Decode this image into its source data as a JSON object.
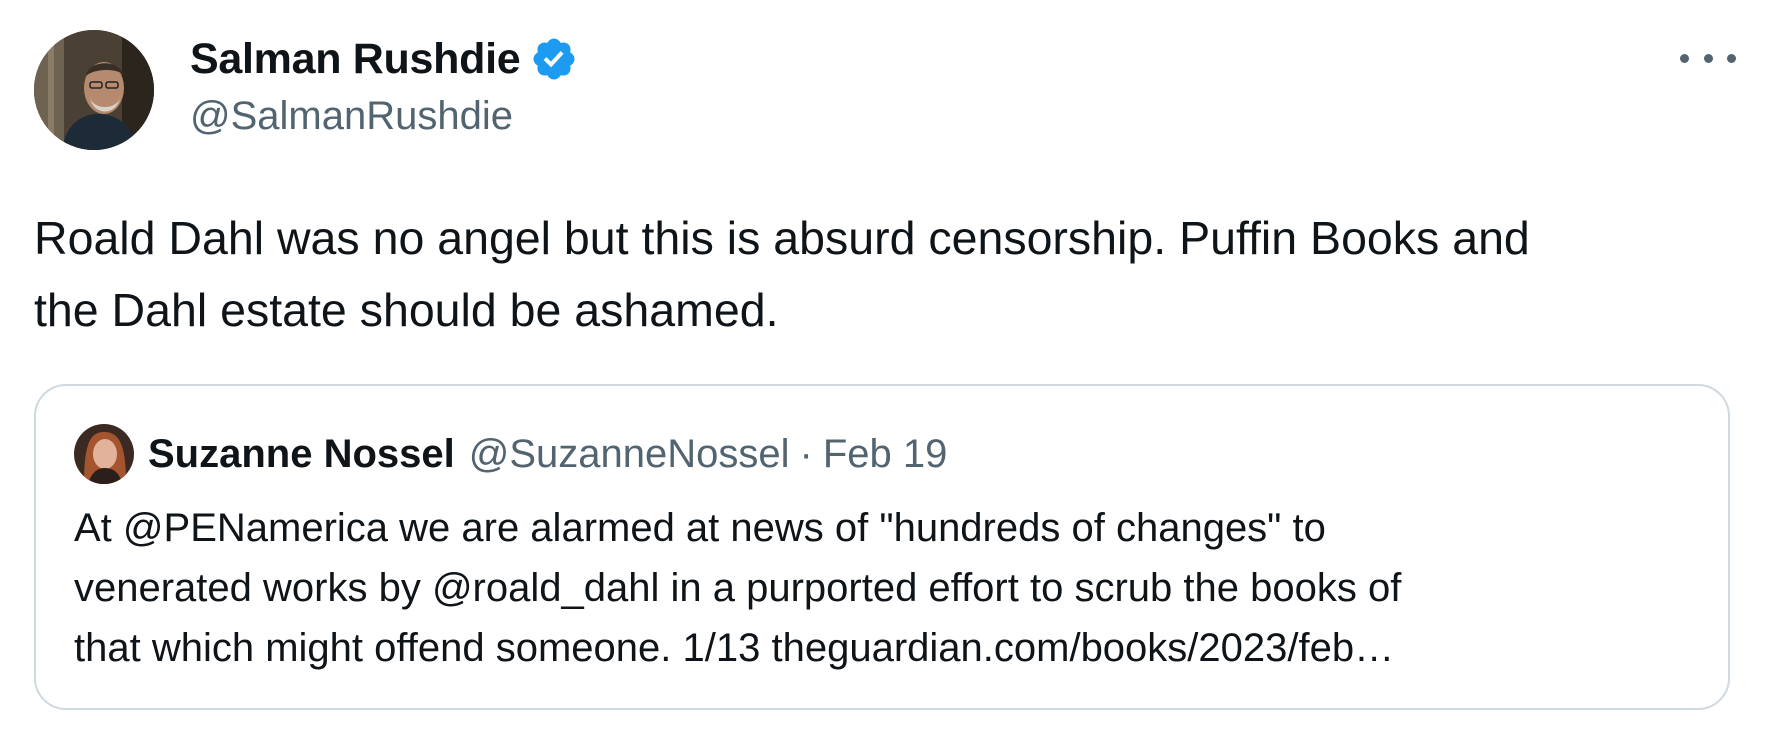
{
  "tweet": {
    "author": {
      "display_name": "Salman Rushdie",
      "handle": "@SalmanRushdie",
      "verified": true
    },
    "text_line1": "Roald Dahl was no angel but this is absurd censorship. Puffin Books and",
    "text_line2": "the Dahl estate should be ashamed.",
    "menu_icon": "more-horizontal-icon",
    "quoted": {
      "display_name": "Suzanne Nossel",
      "handle": "@SuzanneNossel",
      "separator": "·",
      "date": "Feb 19",
      "text_line1": "At @PENamerica we are alarmed at news of \"hundreds of changes\" to",
      "text_line2": "venerated works by @roald_dahl in a purported effort to scrub the books of",
      "text_line3": "that which might offend someone. 1/13 theguardian.com/books/2023/feb…"
    }
  },
  "colors": {
    "text_primary": "#0f1419",
    "text_secondary": "#536471",
    "verified_blue": "#1d9bf0",
    "border": "#cfd9de"
  }
}
